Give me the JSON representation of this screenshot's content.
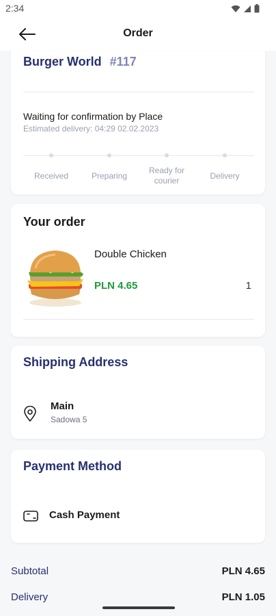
{
  "status_bar": {
    "time": "2:34",
    "icons": [
      "wifi-icon",
      "signal-icon",
      "battery-icon"
    ]
  },
  "app_bar": {
    "title": "Order",
    "back_icon": "arrow-left-icon"
  },
  "order": {
    "restaurant": "Burger World",
    "number": "#117",
    "status": "Waiting for confirmation by Place",
    "estimated_delivery": "Estimated delivery: 04:29 02.02.2023",
    "steps": [
      {
        "label": "Received"
      },
      {
        "label": "Preparing"
      },
      {
        "label": "Ready for courier"
      },
      {
        "label": "Delivery"
      }
    ]
  },
  "your_order": {
    "title": "Your order",
    "items": [
      {
        "name": "Double Chicken",
        "price": "PLN 4.65",
        "qty": "1",
        "image": "burger-image"
      }
    ]
  },
  "shipping": {
    "title": "Shipping Address",
    "icon": "map-pin-icon",
    "name": "Main",
    "street": "Sadowa 5"
  },
  "payment": {
    "title": "Payment Method",
    "icon": "cash-icon",
    "method": "Cash Payment"
  },
  "summary": {
    "subtotal_label": "Subtotal",
    "subtotal_value": "PLN 4.65",
    "delivery_label": "Delivery",
    "delivery_value": "PLN 1.05"
  },
  "colors": {
    "navy": "#26306e",
    "order_number": "#7f86b6",
    "price_green": "#1f9a3a",
    "muted": "#9aa0b4",
    "background": "#f6f7f9"
  }
}
